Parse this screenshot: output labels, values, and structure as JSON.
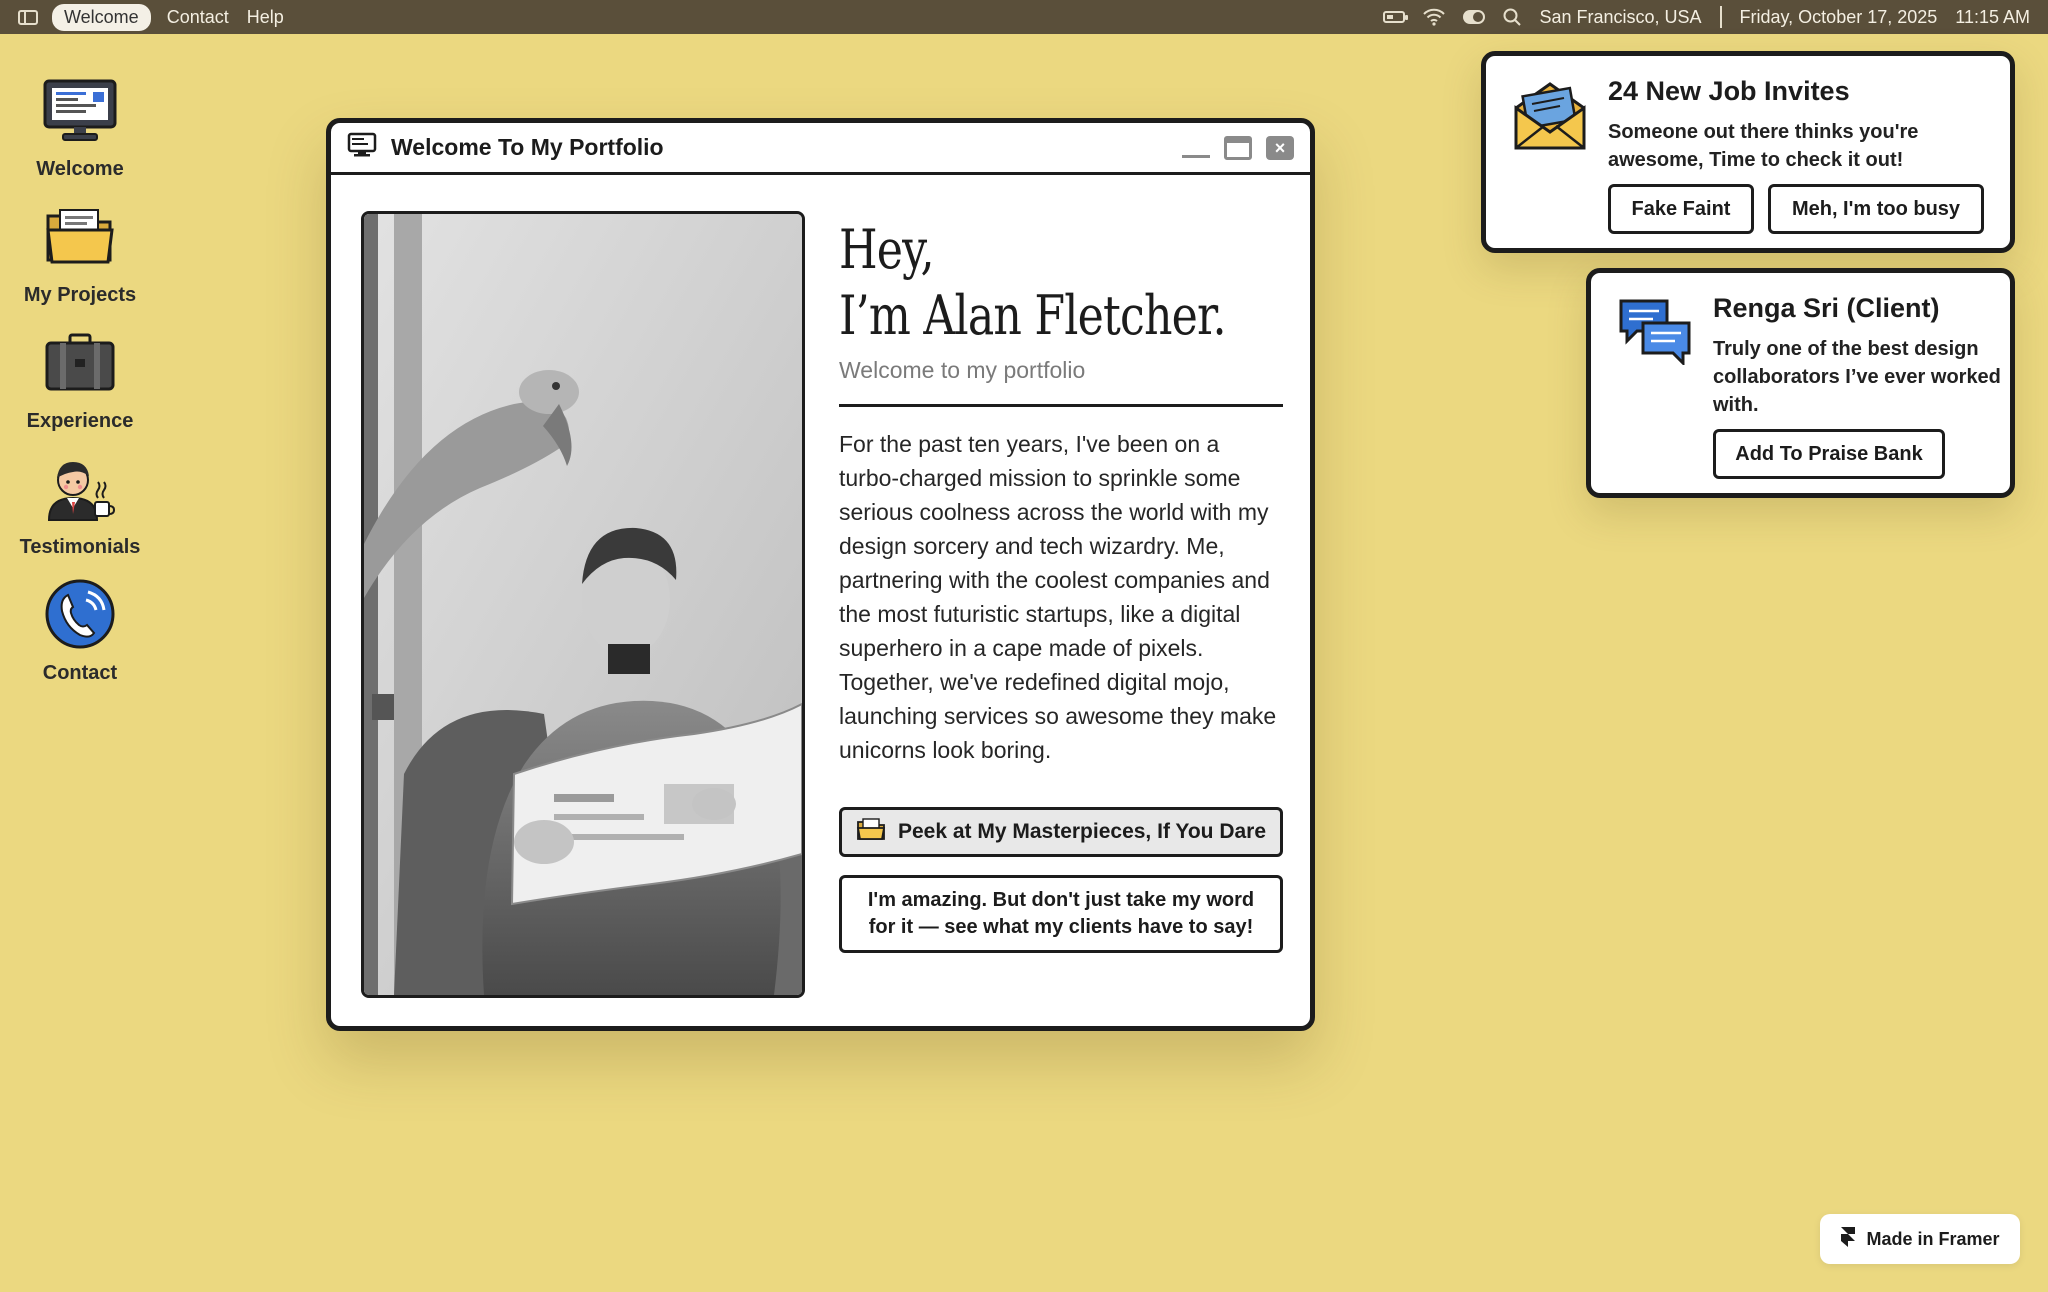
{
  "menubar": {
    "items": [
      "Welcome",
      "Contact",
      "Help"
    ],
    "location": "San Francisco, USA",
    "date": "Friday, October 17, 2025",
    "time": "11:15 AM"
  },
  "desktop": {
    "icons": [
      {
        "label": "Welcome",
        "icon": "computer-icon"
      },
      {
        "label": "My Projects",
        "icon": "folder-icon"
      },
      {
        "label": "Experience",
        "icon": "briefcase-icon"
      },
      {
        "label": "Testimonials",
        "icon": "person-coffee-icon"
      },
      {
        "label": "Contact",
        "icon": "phone-icon"
      }
    ]
  },
  "window": {
    "title": "Welcome To My Portfolio",
    "greeting_line1": "Hey,",
    "greeting_line2": "I’m Alan Fletcher.",
    "subtitle": "Welcome to my portfolio",
    "bio": "For the past ten years, I've been on a turbo-charged mission to sprinkle some serious coolness across the world with my design sorcery and tech wizardry. Me, partnering with the coolest companies and the most futuristic startups, like a digital superhero in a cape made of pixels. Together, we've redefined digital mojo, launching services so awesome they make unicorns look boring.",
    "primary_button": "Peek at My Masterpieces, If You Dare",
    "secondary_button": "I'm amazing. But don't just take my word for it — see what my clients have to say!"
  },
  "notifications": [
    {
      "title": "24 New Job Invites",
      "body": "Someone out there thinks you're awesome, Time to check it out!",
      "buttons": [
        "Fake Faint",
        "Meh, I'm too busy"
      ]
    },
    {
      "title": "Renga Sri (Client)",
      "body": "Truly one of the best design collaborators I’ve ever worked with.",
      "buttons": [
        "Add To Praise Bank"
      ]
    }
  ],
  "badge": {
    "label": "Made in Framer"
  },
  "colors": {
    "desktop_bg": "#ebd880",
    "menubar_bg": "#5a4f3a",
    "window_border": "#1c1c1c"
  }
}
